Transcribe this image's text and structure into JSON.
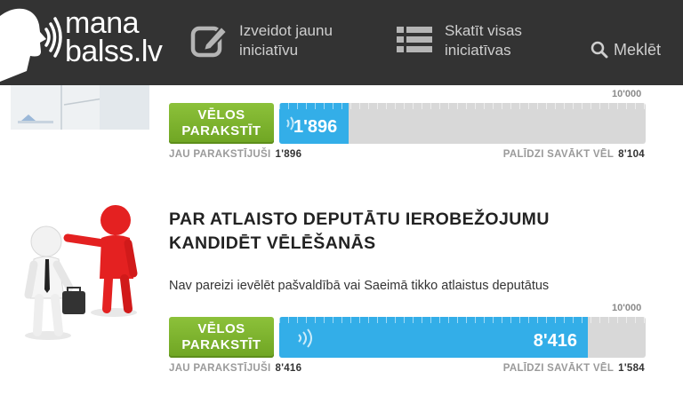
{
  "header": {
    "logo_text_line1": "mana",
    "logo_text_line2": "balss.lv",
    "nav_create_line1": "Izveidot jaunu",
    "nav_create_line2": "iniciatīvu",
    "nav_all_line1": "Skatīt visas",
    "nav_all_line2": "iniciatīvas",
    "search_label": "Meklēt"
  },
  "initiatives": [
    {
      "title_line1": "",
      "title_line2": "",
      "description": "",
      "sign_label_line1": "VĒLOS",
      "sign_label_line2": "PARAKSTĪT",
      "goal": "10'000",
      "count": "1'896",
      "progress_fraction": 0.1896,
      "signed_label": "JAU PARAKSTĪJUŠI",
      "signed_value": "1'896",
      "remaining_label": "PALĪDZI SAVĀKT VĒL",
      "remaining_value": "8'104"
    },
    {
      "title_line1": "PAR ATLAISTO DEPUTĀTU IEROBEŽOJUMU",
      "title_line2": "KANDIDĒT VĒLĒŠANĀS",
      "description": "Nav pareizi ievēlēt pašvaldībā vai Saeimā tikko atlaistus deputātus",
      "sign_label_line1": "VĒLOS",
      "sign_label_line2": "PARAKSTĪT",
      "goal": "10'000",
      "count": "8'416",
      "progress_fraction": 0.8416,
      "signed_label": "JAU PARAKSTĪJUŠI",
      "signed_value": "8'416",
      "remaining_label": "PALĪDZI SAVĀKT VĒL",
      "remaining_value": "1'584"
    }
  ],
  "colors": {
    "header_bg": "#333333",
    "sign_button": "#7ab32e",
    "progress_fill": "#33aee8",
    "progress_track": "#d8d8d8"
  }
}
